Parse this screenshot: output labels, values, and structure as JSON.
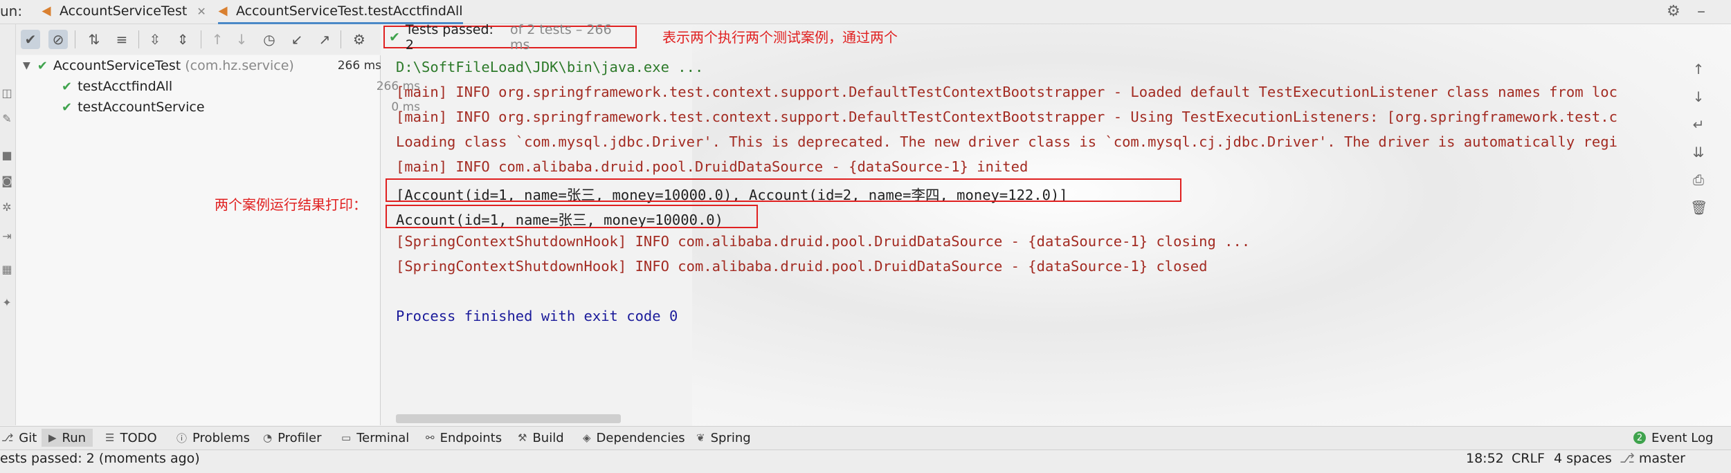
{
  "tabs": {
    "run_label": "un:",
    "items": [
      {
        "label": "AccountServiceTest"
      },
      {
        "label": "AccountServiceTest.testAcctfindAll"
      }
    ]
  },
  "status": {
    "passed_label": "Tests passed: 2",
    "detail": "of 2 tests – 266 ms"
  },
  "annotations": {
    "top": "表示两个执行两个测试案例，通过两个",
    "left": "两个案例运行结果打印："
  },
  "tree": {
    "root": {
      "name": "AccountServiceTest",
      "pkg": "(com.hz.service)",
      "duration": "266 ms"
    },
    "children": [
      {
        "name": "testAcctfindAll",
        "duration": "266 ms"
      },
      {
        "name": "testAccountService",
        "duration": "0 ms"
      }
    ]
  },
  "console": {
    "lines": [
      "D:\\SoftFileLoad\\JDK\\bin\\java.exe ...",
      "[main] INFO org.springframework.test.context.support.DefaultTestContextBootstrapper - Loaded default TestExecutionListener class names from loc",
      "[main] INFO org.springframework.test.context.support.DefaultTestContextBootstrapper - Using TestExecutionListeners: [org.springframework.test.c",
      "Loading class `com.mysql.jdbc.Driver'. This is deprecated. The new driver class is `com.mysql.cj.jdbc.Driver'. The driver is automatically regi",
      "[main] INFO com.alibaba.druid.pool.DruidDataSource - {dataSource-1} inited",
      "[Account(id=1, name=张三, money=10000.0), Account(id=2, name=李四, money=122.0)]",
      "Account(id=1, name=张三, money=10000.0)",
      "[SpringContextShutdownHook] INFO com.alibaba.druid.pool.DruidDataSource - {dataSource-1} closing ...",
      "[SpringContextShutdownHook] INFO com.alibaba.druid.pool.DruidDataSource - {dataSource-1} closed",
      "Process finished with exit code 0"
    ]
  },
  "toolwindows": {
    "git": "Git",
    "run": "Run",
    "todo": "TODO",
    "problems": "Problems",
    "profiler": "Profiler",
    "terminal": "Terminal",
    "endpoints": "Endpoints",
    "build": "Build",
    "dependencies": "Dependencies",
    "spring": "Spring",
    "event_log": "Event Log",
    "event_count": "2"
  },
  "statusbar": {
    "message": "ests passed: 2 (moments ago)",
    "time": "18:52",
    "line_sep": "CRLF",
    "indent": "4 spaces",
    "branch": "master"
  },
  "colors": {
    "pass_green": "#3fa34d",
    "annotation_red": "#e02020",
    "console_red": "#a32b22",
    "console_blue": "#1a1a9a"
  }
}
